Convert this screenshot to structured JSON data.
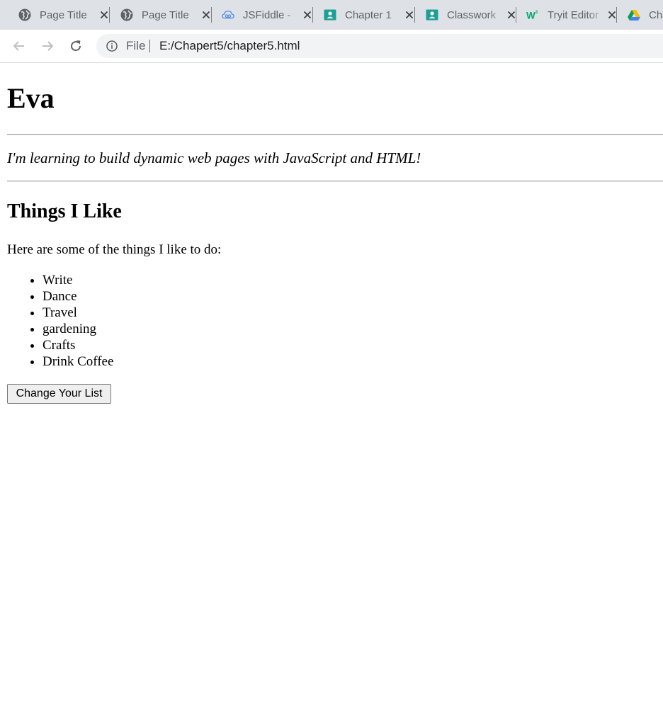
{
  "browser": {
    "tabs": [
      {
        "title": "Page Title",
        "icon": "globe-icon"
      },
      {
        "title": "Page Title",
        "icon": "globe-icon"
      },
      {
        "title": "JSFiddle -",
        "icon": "jsfiddle-cloud-icon"
      },
      {
        "title": "Chapter 1",
        "icon": "classroom-icon"
      },
      {
        "title": "Classwork",
        "icon": "classroom-icon"
      },
      {
        "title": "Tryit Editor",
        "icon": "w3schools-icon"
      },
      {
        "title": "Cha",
        "icon": "google-drive-icon"
      }
    ],
    "address_bar": {
      "scheme_label": "File",
      "url": "E:/Chapert5/chapter5.html"
    }
  },
  "page": {
    "heading": "Eva",
    "tagline": "I'm learning to build dynamic web pages with JavaScript and HTML!",
    "section_heading": "Things I Like",
    "intro": "Here are some of the things I like to do:",
    "likes": [
      "Write",
      "Dance",
      "Travel",
      "gardening",
      "Crafts",
      "Drink Coffee"
    ],
    "button_label": "Change Your List"
  }
}
